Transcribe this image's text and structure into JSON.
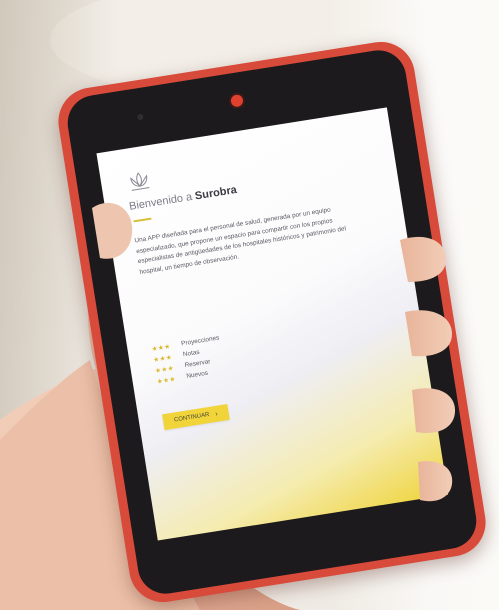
{
  "screen": {
    "title_prefix": "Bienvenido a",
    "title_brand": "Surobra",
    "body": "Una APP diseñada para el personal de salud, generada por un equipo especializado, que propone un espacio para compartir con los propios especialistas de antigüedades de los hospitales históricos y patrimonio del hospital, un tiempo de observación.",
    "list_items": [
      {
        "stars": "★★★",
        "label": "Proyecciones"
      },
      {
        "stars": "★★★",
        "label": "Notas"
      },
      {
        "stars": "★★★",
        "label": "Reservar"
      },
      {
        "stars": "★★★",
        "label": "Nuevos"
      }
    ],
    "cta_label": "CONTINUAR",
    "cta_arrow": "›"
  },
  "colors": {
    "phone_body": "#d84a3a",
    "accent_yellow": "#f1d43a",
    "screen_bezel": "#1c1a1c"
  }
}
